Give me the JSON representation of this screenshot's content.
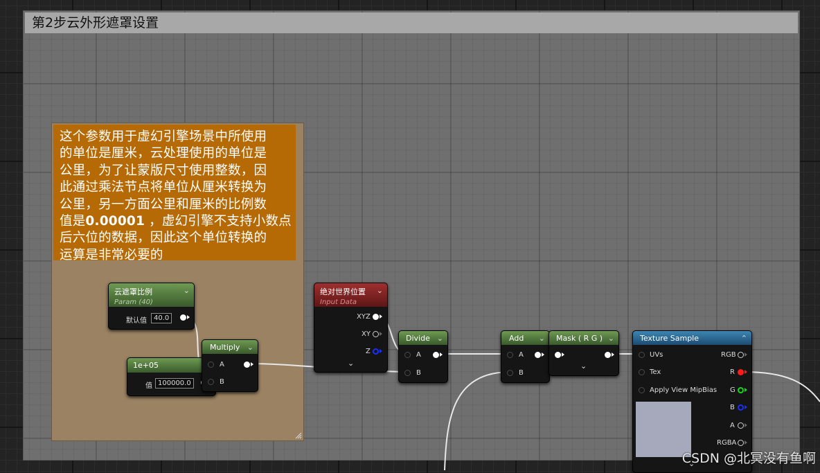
{
  "comments": {
    "outer_title": "第2步云外形遮罩设置",
    "inner_lines": [
      "这个参数用于虚幻引擎场景中所使用",
      "的单位是厘米，云处理使用的单位是",
      "公里，为了让蒙版尺寸使用整数，因",
      "此通过乘法节点将单位从厘米转换为",
      "公里，另一方面公里和厘米的比例数"
    ],
    "inner_line6_pre": "值是",
    "inner_line6_bold": "0.00001",
    "inner_line6_post": " ，虚幻引擎不支持小数点",
    "inner_lines_end": [
      "后六位的数据，因此这个单位转换的",
      "运算是非常必要的"
    ]
  },
  "nodes": {
    "param": {
      "title": "云遮罩比例",
      "subtitle": "Param (40)",
      "field_label": "默认值",
      "value": "40.0"
    },
    "constant": {
      "title": "1e+05",
      "field_label": "值",
      "value": "100000.0"
    },
    "multiply": {
      "title": "Multiply",
      "pin_a": "A",
      "pin_b": "B"
    },
    "world_pos": {
      "title": "绝对世界位置",
      "subtitle": "Input Data",
      "pin_xyz": "XYZ",
      "pin_xy": "XY",
      "pin_z": "Z"
    },
    "divide": {
      "title": "Divide",
      "pin_a": "A",
      "pin_b": "B"
    },
    "add": {
      "title": "Add",
      "pin_a": "A",
      "pin_b": "B"
    },
    "mask": {
      "title": "Mask ( R G )"
    },
    "texture": {
      "title": "Texture Sample",
      "in_uvs": "UVs",
      "in_tex": "Tex",
      "in_mip": "Apply View MipBias",
      "out_rgb": "RGB",
      "out_r": "R",
      "out_g": "G",
      "out_b": "B",
      "out_a": "A",
      "out_rgba": "RGBA",
      "preview_color": "#a6a8bc"
    }
  },
  "icons": {
    "collapse": "chevron-down-icon",
    "collapse_up": "chevron-up-icon",
    "expand": "expand-arrow-icon"
  },
  "colors": {
    "comment_orange": "#b56a05",
    "comment_tan": "#9a8262",
    "header_green": "#4f7a3c",
    "header_red": "#8a2424",
    "header_blue": "#2a6a96",
    "pin_r": "#ff1b1b",
    "pin_g": "#11dd11",
    "pin_b": "#1830ff"
  },
  "watermark": "CSDN @北冥没有鱼啊"
}
